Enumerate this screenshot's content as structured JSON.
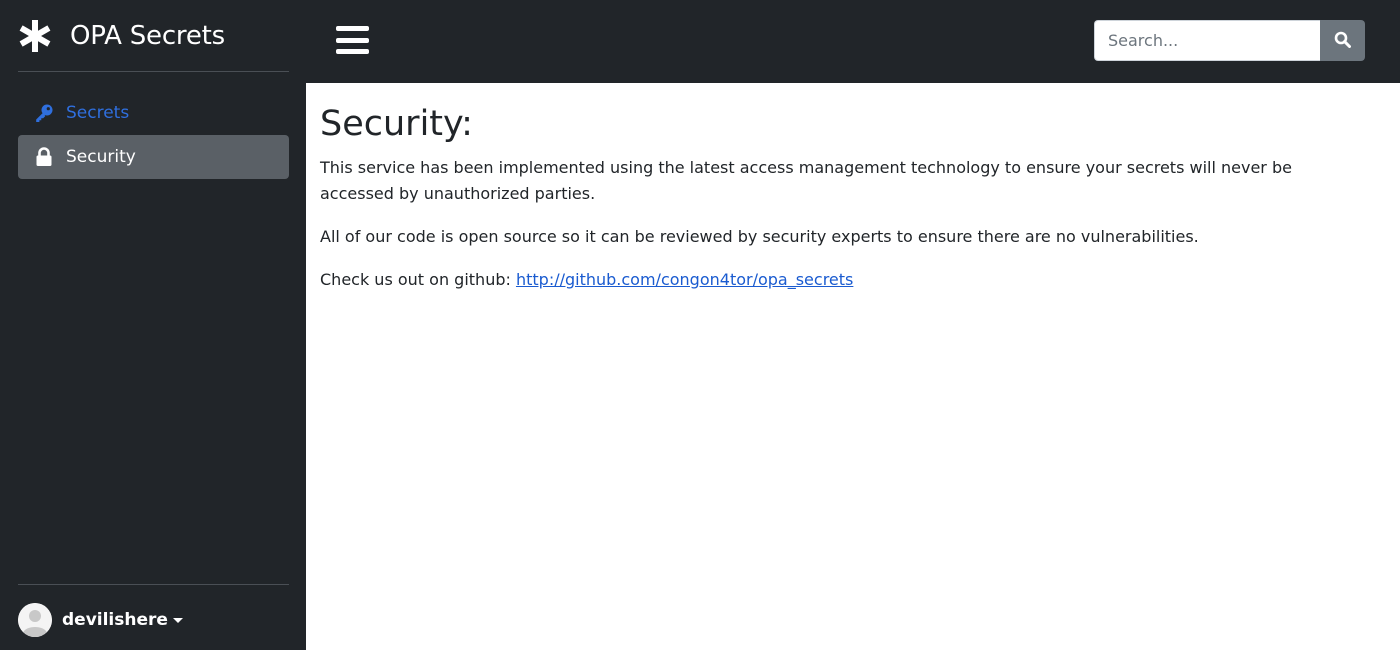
{
  "brand": {
    "title": "OPA Secrets",
    "icon": "asterisk-icon"
  },
  "sidebar": {
    "items": [
      {
        "label": "Secrets",
        "icon": "key-icon",
        "active": false
      },
      {
        "label": "Security",
        "icon": "lock-icon",
        "active": true
      }
    ],
    "user": {
      "name": "devilishere",
      "icon": "user-avatar"
    }
  },
  "topbar": {
    "menu_icon": "hamburger-menu-icon",
    "search": {
      "placeholder": "Search...",
      "value": "",
      "button_icon": "search-icon"
    }
  },
  "main": {
    "title": "Security:",
    "paragraph1": "This service has been implemented using the latest access management technology to ensure your secrets will never be accessed by unauthorized parties.",
    "paragraph2": "All of our code is open source so it can be reviewed by security experts to ensure there are no vulnerabilities.",
    "github_prefix": "Check us out on github: ",
    "github_link": "http://github.com/congon4tor/opa_secrets"
  },
  "colors": {
    "dark_bg": "#212529",
    "active_item": "#5a6066",
    "link_blue": "#2f6fde",
    "search_button": "#6c757d"
  }
}
